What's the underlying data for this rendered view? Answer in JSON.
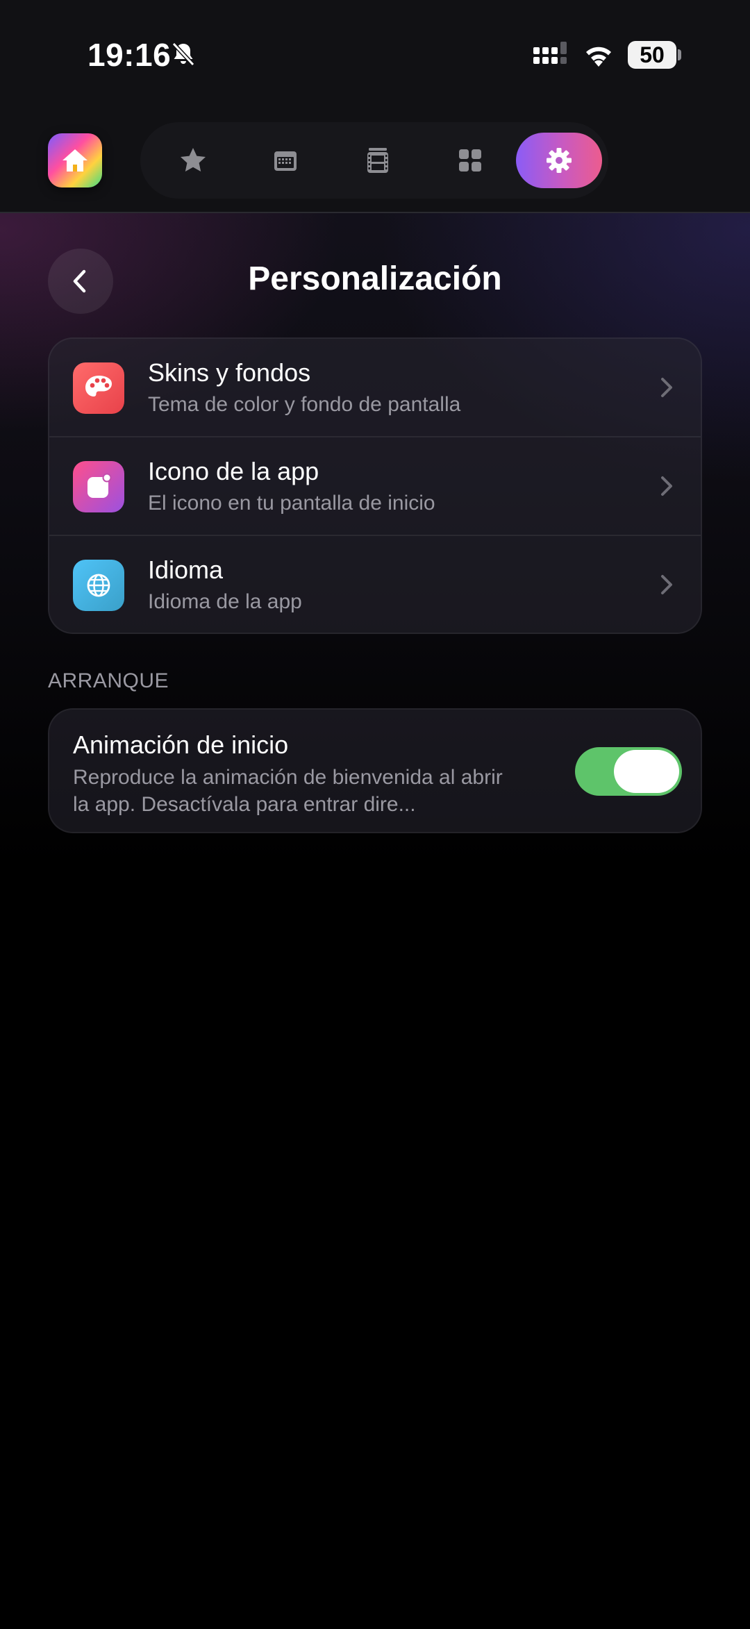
{
  "status_bar": {
    "time": "19:16",
    "battery": "50"
  },
  "header": {
    "title": "Personalización"
  },
  "settings": {
    "items": [
      {
        "title": "Skins y fondos",
        "subtitle": "Tema de color y fondo de pantalla",
        "icon": "palette-icon"
      },
      {
        "title": "Icono de la app",
        "subtitle": "El icono en tu pantalla de inicio",
        "icon": "app-icon-icon"
      },
      {
        "title": "Idioma",
        "subtitle": "Idioma de la app",
        "icon": "globe-icon"
      }
    ]
  },
  "startup": {
    "section_label": "ARRANQUE",
    "title": "Animación de inicio",
    "subtitle": "Reproduce la animación de bienvenida al abrir la app. Desactívala para entrar dire...",
    "enabled": true
  },
  "colors": {
    "toggle_on": "#5ec46a",
    "active_tab_start": "#8b5cf6",
    "active_tab_end": "#ec5c8e"
  }
}
